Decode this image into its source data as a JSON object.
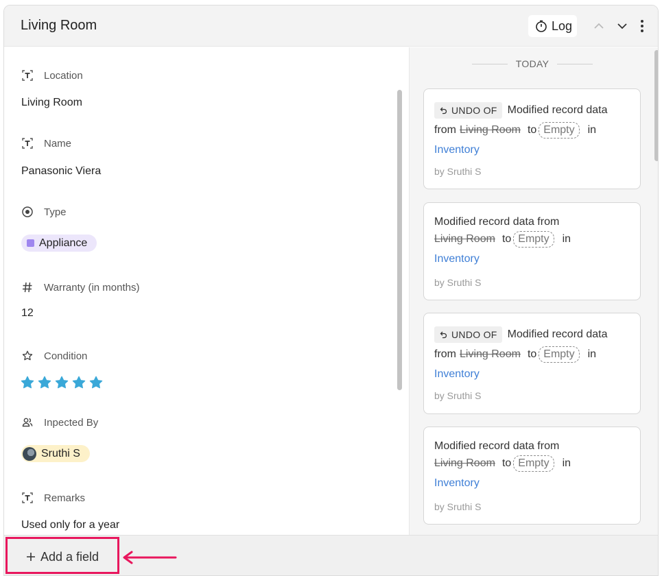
{
  "header": {
    "title": "Living Room",
    "log_label": "Log",
    "icons": [
      "timer-icon",
      "chevron-up-icon",
      "chevron-down-icon",
      "more-vertical-icon"
    ]
  },
  "fields": {
    "location": {
      "label": "Location",
      "value": "Living Room",
      "icon": "text-field-icon"
    },
    "name": {
      "label": "Name",
      "value": "Panasonic Viera",
      "icon": "text-field-icon"
    },
    "type": {
      "label": "Type",
      "value": "Appliance",
      "icon": "radio-target-icon",
      "color": "#9f86ef"
    },
    "warranty": {
      "label": "Warranty (in months)",
      "value": "12",
      "icon": "hash-icon"
    },
    "condition": {
      "label": "Condition",
      "rating": 5,
      "max": 5,
      "star_color": "#3aa8d8",
      "icon": "star-outline-icon"
    },
    "inspected_by": {
      "label": "Inpected By",
      "value": "Sruthi S",
      "icon": "users-icon"
    },
    "remarks": {
      "label": "Remarks",
      "value": "Used only for a year",
      "icon": "text-field-icon"
    }
  },
  "log": {
    "group_label": "TODAY",
    "entries": [
      {
        "undo_label": "UNDO OF",
        "text": "Modified record data",
        "from_word": "from",
        "old_value": "Living Room",
        "to_word": "to",
        "new_value": "Empty",
        "in_word": "in",
        "table": "Inventory",
        "author": "by Sruthi S"
      },
      {
        "text": "Modified record data from",
        "old_value": "Living Room",
        "to_word": "to",
        "new_value": "Empty",
        "in_word": "in",
        "table": "Inventory",
        "author": "by Sruthi S"
      },
      {
        "undo_label": "UNDO OF",
        "text": "Modified record data",
        "from_word": "from",
        "old_value": "Living Room",
        "to_word": "to",
        "new_value": "Empty",
        "in_word": "in",
        "table": "Inventory",
        "author": "by Sruthi S"
      },
      {
        "text": "Modified record data from",
        "old_value": "Living Room",
        "to_word": "to",
        "new_value": "Empty",
        "in_word": "in",
        "table": "Inventory",
        "author": "by Sruthi S"
      }
    ]
  },
  "footer": {
    "add_field_label": "Add a field"
  },
  "colors": {
    "accent_link": "#3f7fd6",
    "highlight": "#e8175d"
  }
}
